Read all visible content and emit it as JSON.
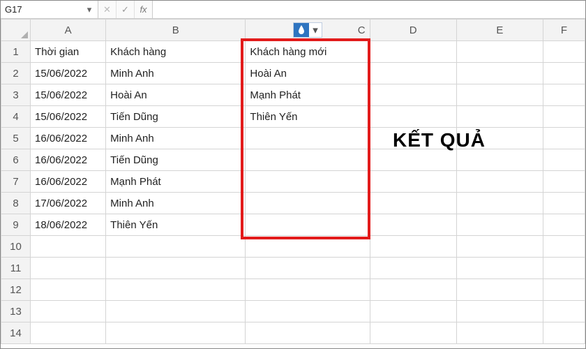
{
  "namebox": {
    "value": "G17"
  },
  "fx": {
    "cancel": "✕",
    "confirm": "✓",
    "symbol": "fx"
  },
  "columns": [
    "A",
    "B",
    "C",
    "D",
    "E",
    "F"
  ],
  "row_numbers": [
    "1",
    "2",
    "3",
    "4",
    "5",
    "6",
    "7",
    "8",
    "9",
    "10",
    "11",
    "12",
    "13",
    "14"
  ],
  "icons": {
    "caret_down": "▾",
    "drop": "💧"
  },
  "header_row": {
    "A": "Thời gian",
    "B": "Khách hàng",
    "C": "Khách hàng mới"
  },
  "rows": [
    {
      "A": "15/06/2022",
      "B": "Minh Anh",
      "C": "Hoài An"
    },
    {
      "A": "15/06/2022",
      "B": "Hoài An",
      "C": "Mạnh Phát"
    },
    {
      "A": "15/06/2022",
      "B": "Tiến Dũng",
      "C": "Thiên Yến"
    },
    {
      "A": "16/06/2022",
      "B": "Minh Anh",
      "C": ""
    },
    {
      "A": "16/06/2022",
      "B": "Tiến Dũng",
      "C": ""
    },
    {
      "A": "16/06/2022",
      "B": "Mạnh Phát",
      "C": ""
    },
    {
      "A": "17/06/2022",
      "B": "Minh Anh",
      "C": ""
    },
    {
      "A": "18/06/2022",
      "B": "Thiên Yến",
      "C": ""
    }
  ],
  "result_label": "KẾT QUẢ",
  "chart_data": {
    "type": "table",
    "title": "",
    "columns": [
      "Thời gian",
      "Khách hàng",
      "Khách hàng mới"
    ],
    "data": [
      [
        "15/06/2022",
        "Minh Anh",
        "Hoài An"
      ],
      [
        "15/06/2022",
        "Hoài An",
        "Mạnh Phát"
      ],
      [
        "15/06/2022",
        "Tiến Dũng",
        "Thiên Yến"
      ],
      [
        "16/06/2022",
        "Minh Anh",
        ""
      ],
      [
        "16/06/2022",
        "Tiến Dũng",
        ""
      ],
      [
        "16/06/2022",
        "Mạnh Phát",
        ""
      ],
      [
        "17/06/2022",
        "Minh Anh",
        ""
      ],
      [
        "18/06/2022",
        "Thiên Yến",
        ""
      ]
    ]
  }
}
